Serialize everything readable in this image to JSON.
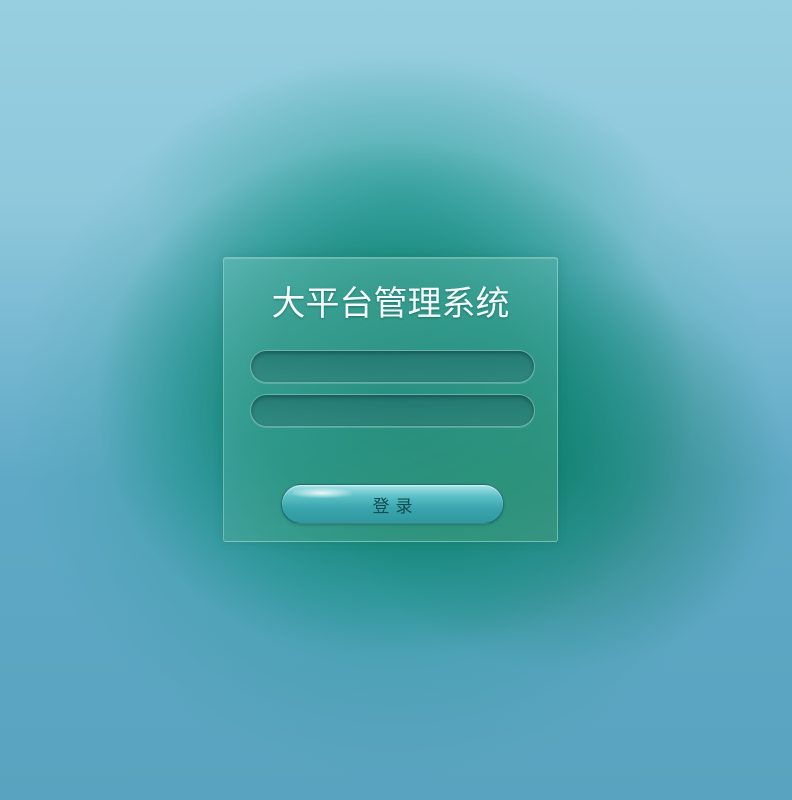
{
  "login": {
    "title": "大平台管理系统",
    "username": {
      "value": "",
      "placeholder": ""
    },
    "password": {
      "value": "",
      "placeholder": ""
    },
    "submit_label": "登录"
  },
  "colors": {
    "title_text": "#f4fbfb",
    "button_text": "#134b52",
    "button_fill": "#3ba5ad",
    "background_center": "#0c826e",
    "background_edge": "#8fc8dc"
  }
}
